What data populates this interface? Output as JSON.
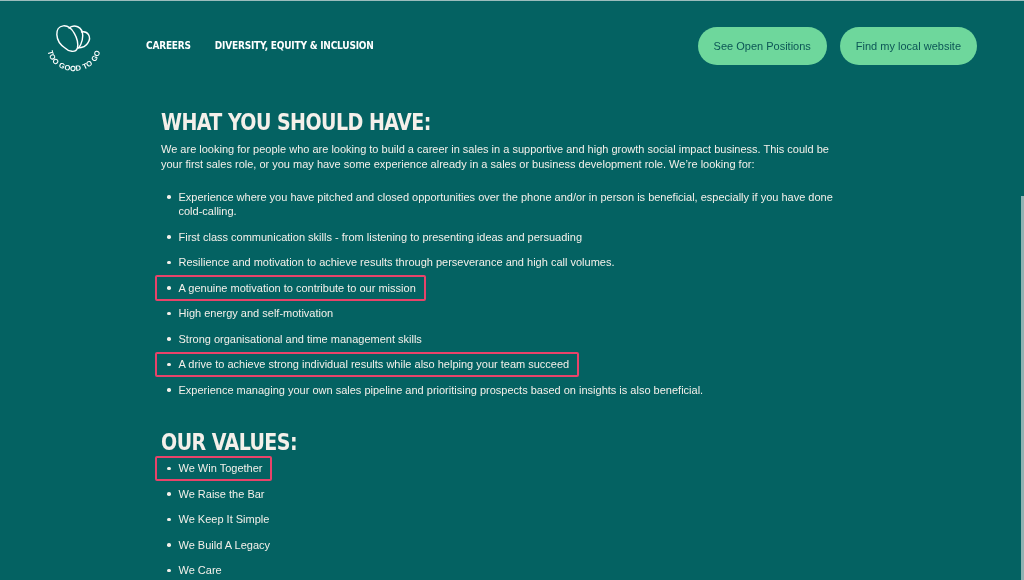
{
  "header": {
    "logo_text": "TOO GOOD TO GO",
    "nav": [
      "CAREERS",
      "DIVERSITY, EQUITY & INCLUSION"
    ],
    "buttons": [
      "See Open Positions",
      "Find my local website"
    ]
  },
  "sections": [
    {
      "heading": "WHAT YOU SHOULD HAVE:",
      "intro": "We are looking for people who are looking to build a career in sales in a supportive and high growth social impact business. This could be your first sales role, or you may have some experience already in a sales or business development role. We’re looking for:",
      "items": [
        {
          "text": "Experience where you have pitched and closed opportunities over the phone and/or in person is beneficial, especially if you have done cold-calling.",
          "highlighted": false
        },
        {
          "text": "First class communication skills - from listening to presenting ideas and persuading",
          "highlighted": false
        },
        {
          "text": "Resilience and motivation to achieve results through perseverance and high call volumes.",
          "highlighted": false
        },
        {
          "text": "A genuine motivation to contribute to our mission",
          "highlighted": true
        },
        {
          "text": "High energy and self-motivation",
          "highlighted": false
        },
        {
          "text": "Strong organisational and time management skills",
          "highlighted": false
        },
        {
          "text": "A drive to achieve strong individual results while also helping your team succeed",
          "highlighted": true
        },
        {
          "text": "Experience managing your own sales pipeline and prioritising prospects based on insights is also beneficial.",
          "highlighted": false
        }
      ]
    },
    {
      "heading": "OUR VALUES:",
      "items": [
        {
          "text": "We Win Together",
          "highlighted": true
        },
        {
          "text": "We Raise the Bar",
          "highlighted": false
        },
        {
          "text": "We Keep It Simple",
          "highlighted": false
        },
        {
          "text": "We Build A Legacy",
          "highlighted": false
        },
        {
          "text": "We Care",
          "highlighted": false
        }
      ]
    }
  ]
}
